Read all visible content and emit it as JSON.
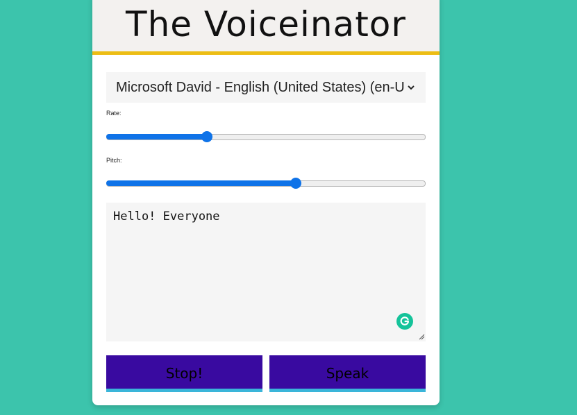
{
  "app": {
    "title": "The Voiceinator"
  },
  "voice_select": {
    "selected": "Microsoft David - English (United States) (en-US)"
  },
  "rate": {
    "label": "Rate:",
    "value_fraction": 0.31
  },
  "pitch": {
    "label": "Pitch:",
    "value_fraction": 0.6
  },
  "message": {
    "value": "Hello! Everyone"
  },
  "buttons": {
    "stop_label": "Stop!",
    "speak_label": "Speak"
  },
  "colors": {
    "page_background": "#3cc4ac",
    "header_border": "#ecbd14",
    "slider_accent": "#0f73e8",
    "button_background": "#390aa0",
    "button_border": "#3ab5d9",
    "grammarly_badge": "#15c39a"
  },
  "icons": {
    "select_arrow": "chevron-down-icon",
    "grammarly": "grammarly-icon",
    "resize": "resize-handle-icon"
  }
}
